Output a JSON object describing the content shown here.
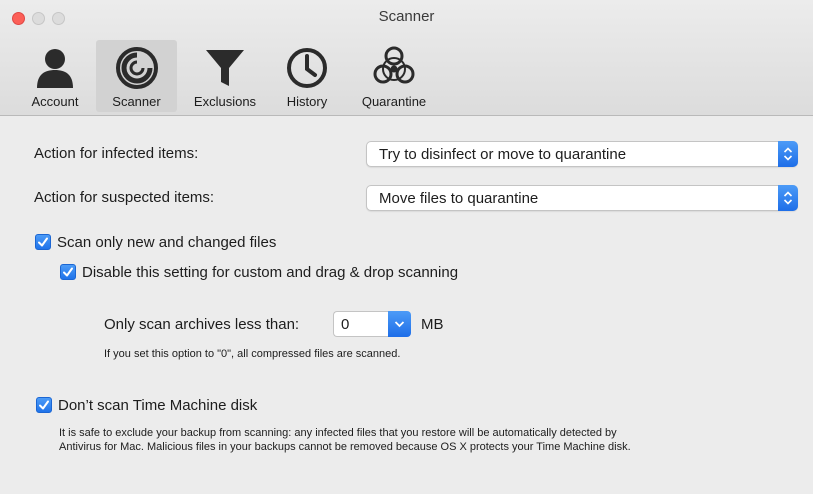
{
  "window": {
    "title": "Scanner"
  },
  "toolbar": {
    "items": [
      {
        "label": "Account",
        "icon": "account-icon"
      },
      {
        "label": "Scanner",
        "icon": "scanner-icon",
        "selected": true
      },
      {
        "label": "Exclusions",
        "icon": "exclusions-icon"
      },
      {
        "label": "History",
        "icon": "history-icon"
      },
      {
        "label": "Quarantine",
        "icon": "quarantine-icon"
      }
    ]
  },
  "settings": {
    "infected": {
      "label": "Action for infected items:",
      "value": "Try to disinfect or move to quarantine"
    },
    "suspected": {
      "label": "Action for suspected items:",
      "value": "Move files to quarantine"
    },
    "scan_new_only": {
      "label": "Scan only new and changed files",
      "checked": true
    },
    "disable_custom": {
      "label": "Disable this setting for custom and drag & drop scanning",
      "checked": true
    },
    "archive": {
      "label": "Only scan archives less than:",
      "value": "0",
      "unit": "MB",
      "note": "If you set this option to \"0\", all compressed files are scanned."
    },
    "time_machine": {
      "label": "Don’t scan Time Machine disk",
      "checked": true,
      "note_line1": "It is safe to exclude your backup from scanning: any infected files that you restore will be automatically detected by",
      "note_line2": "Antivirus for Mac. Malicious files in your backups cannot be removed because OS X protects your Time Machine disk."
    }
  },
  "colors": {
    "accent": "#1e6ee8",
    "close": "#fc5f57",
    "window_bg": "#ececec"
  }
}
